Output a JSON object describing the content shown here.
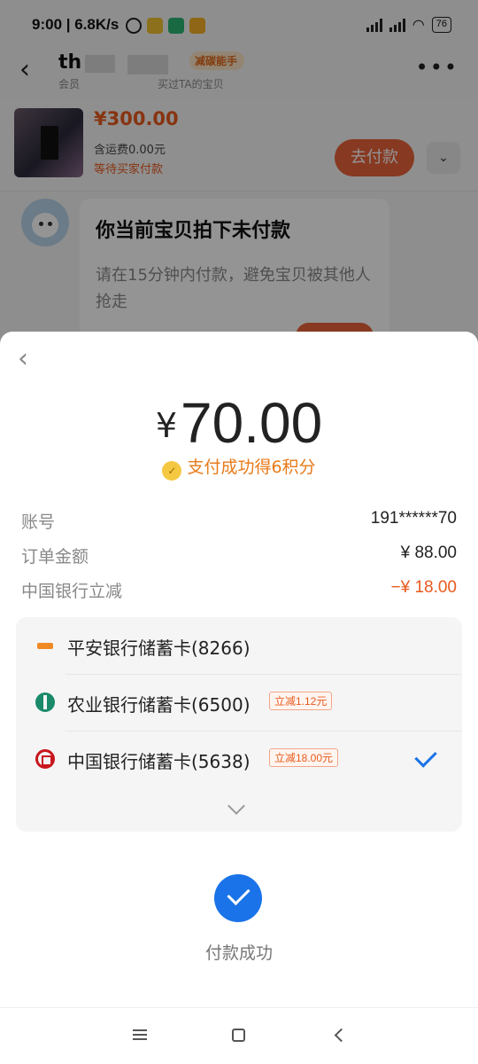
{
  "status_bar": {
    "time_speed": "9:00 | 6.8K/s",
    "battery": "76"
  },
  "chat": {
    "seller_name": "th",
    "member_label": "会员",
    "bought_label": "买过TA的宝贝",
    "badge": "减碳能手",
    "order": {
      "price": "¥300.00",
      "shipping": "含运费0.00元",
      "status": "等待买家付款",
      "pay_button": "去付款"
    },
    "message": {
      "title": "你当前宝贝拍下未付款",
      "text": "请在15分钟内付款，避免宝贝被其他人抢走"
    }
  },
  "payment": {
    "currency": "¥",
    "amount": "70.00",
    "points_text": "支付成功得6积分",
    "details": [
      {
        "label": "账号",
        "value": "191******70"
      },
      {
        "label": "订单金额",
        "value": "¥ 88.00"
      },
      {
        "label": "中国银行立减",
        "value": "−¥ 18.00"
      }
    ],
    "banks": [
      {
        "name": "平安银行储蓄卡(8266)",
        "promo": ""
      },
      {
        "name": "农业银行储蓄卡(6500)",
        "promo": "立减1.12元"
      },
      {
        "name": "中国银行储蓄卡(5638)",
        "promo": "立减18.00元"
      }
    ],
    "success_text": "付款成功"
  },
  "colors": {
    "accent_orange": "#e85a1e",
    "accent_blue": "#1a73e8"
  }
}
